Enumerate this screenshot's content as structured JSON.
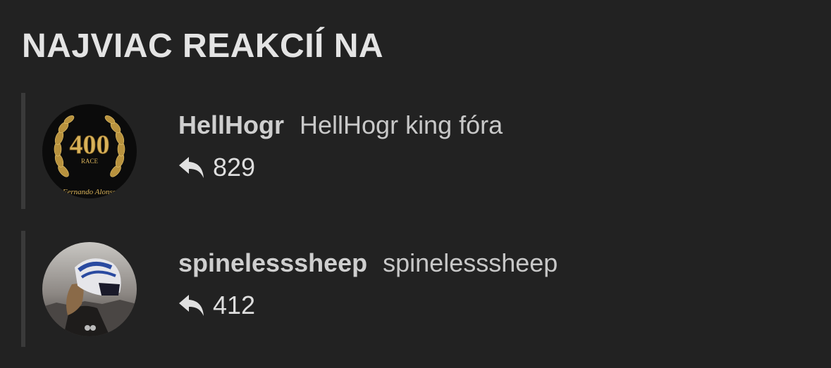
{
  "section": {
    "heading": "NAJVIAC REAKCIÍ NA"
  },
  "users": [
    {
      "username": "HellHogr",
      "title": "HellHogr king fóra",
      "count": "829",
      "avatar_icon": "laurel-400-race-avatar",
      "avatar_text": {
        "number": "400",
        "label": "RACE",
        "caption": "Fernando Alonso"
      }
    },
    {
      "username": "spinelesssheep",
      "title": "spinelesssheep",
      "count": "412",
      "avatar_icon": "helmet-rider-avatar"
    }
  ],
  "colors": {
    "background": "#222222",
    "accent_bar": "#3a3a3a",
    "text": "#dcdcdc",
    "laurel_gold": "#c9a24a"
  }
}
